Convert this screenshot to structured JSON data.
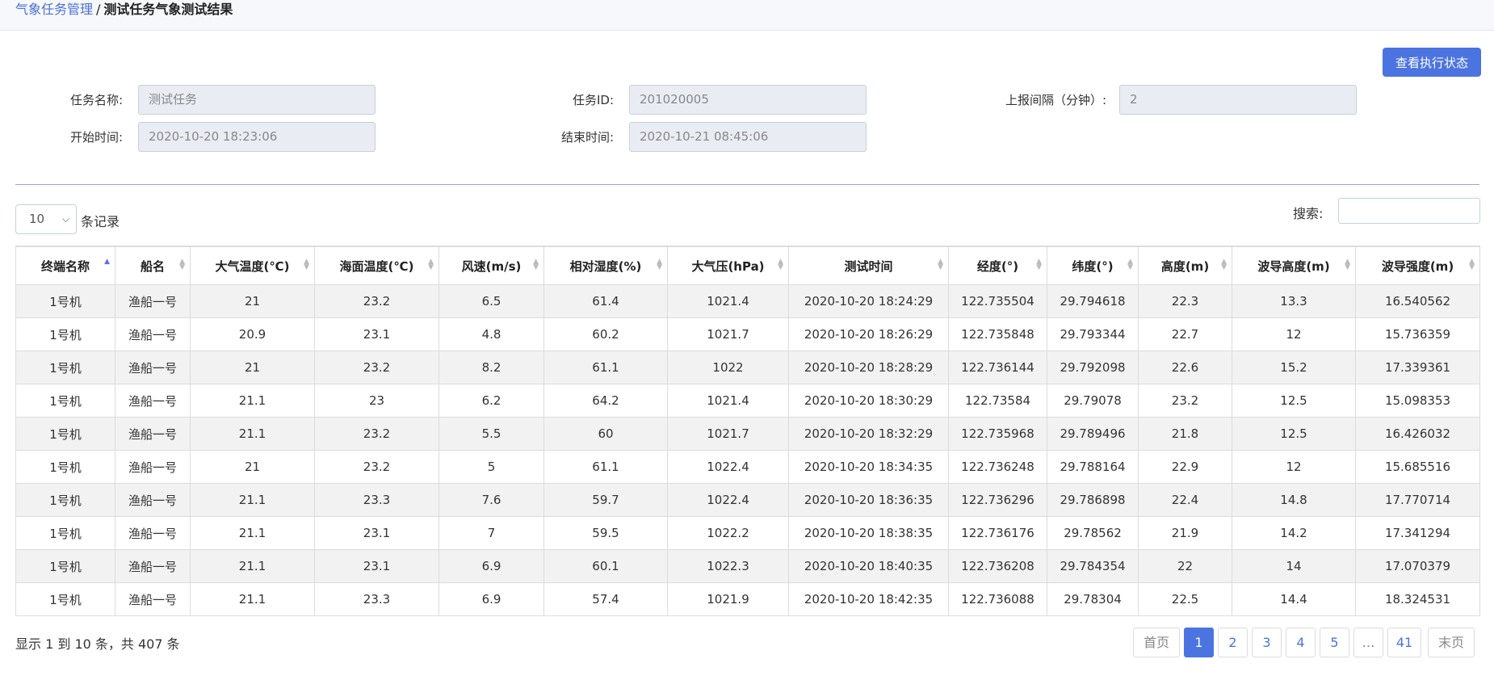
{
  "breadcrumb": {
    "parent": "气象任务管理",
    "separator": "/",
    "current": "测试任务气象测试结果"
  },
  "actions": {
    "view_status": "查看执行状态"
  },
  "form": {
    "task_name_label": "任务名称:",
    "task_name_value": "测试任务",
    "task_id_label": "任务ID:",
    "task_id_value": "201020005",
    "interval_label": "上报间隔（分钟）:",
    "interval_value": "2",
    "start_label": "开始时间:",
    "start_value": "2020-10-20 18:23:06",
    "end_label": "结束时间:",
    "end_value": "2020-10-21 08:45:06"
  },
  "table_controls": {
    "page_length": "10",
    "length_suffix": "条记录",
    "search_label": "搜索:",
    "search_value": ""
  },
  "table": {
    "columns": [
      "终端名称",
      "船名",
      "大气温度(℃)",
      "海面温度(℃)",
      "风速(m/s)",
      "相对湿度(%)",
      "大气压(hPa)",
      "测试时间",
      "经度(°)",
      "纬度(°)",
      "高度(m)",
      "波导高度(m)",
      "波导强度(m)"
    ],
    "rows": [
      [
        "1号机",
        "渔船一号",
        "21",
        "23.2",
        "6.5",
        "61.4",
        "1021.4",
        "2020-10-20 18:24:29",
        "122.735504",
        "29.794618",
        "22.3",
        "13.3",
        "16.540562"
      ],
      [
        "1号机",
        "渔船一号",
        "20.9",
        "23.1",
        "4.8",
        "60.2",
        "1021.7",
        "2020-10-20 18:26:29",
        "122.735848",
        "29.793344",
        "22.7",
        "12",
        "15.736359"
      ],
      [
        "1号机",
        "渔船一号",
        "21",
        "23.2",
        "8.2",
        "61.1",
        "1022",
        "2020-10-20 18:28:29",
        "122.736144",
        "29.792098",
        "22.6",
        "15.2",
        "17.339361"
      ],
      [
        "1号机",
        "渔船一号",
        "21.1",
        "23",
        "6.2",
        "64.2",
        "1021.4",
        "2020-10-20 18:30:29",
        "122.73584",
        "29.79078",
        "23.2",
        "12.5",
        "15.098353"
      ],
      [
        "1号机",
        "渔船一号",
        "21.1",
        "23.2",
        "5.5",
        "60",
        "1021.7",
        "2020-10-20 18:32:29",
        "122.735968",
        "29.789496",
        "21.8",
        "12.5",
        "16.426032"
      ],
      [
        "1号机",
        "渔船一号",
        "21",
        "23.2",
        "5",
        "61.1",
        "1022.4",
        "2020-10-20 18:34:35",
        "122.736248",
        "29.788164",
        "22.9",
        "12",
        "15.685516"
      ],
      [
        "1号机",
        "渔船一号",
        "21.1",
        "23.3",
        "7.6",
        "59.7",
        "1022.4",
        "2020-10-20 18:36:35",
        "122.736296",
        "29.786898",
        "22.4",
        "14.8",
        "17.770714"
      ],
      [
        "1号机",
        "渔船一号",
        "21.1",
        "23.1",
        "7",
        "59.5",
        "1022.2",
        "2020-10-20 18:38:35",
        "122.736176",
        "29.78562",
        "21.9",
        "14.2",
        "17.341294"
      ],
      [
        "1号机",
        "渔船一号",
        "21.1",
        "23.1",
        "6.9",
        "60.1",
        "1022.3",
        "2020-10-20 18:40:35",
        "122.736208",
        "29.784354",
        "22",
        "14",
        "17.070379"
      ],
      [
        "1号机",
        "渔船一号",
        "21.1",
        "23.3",
        "6.9",
        "57.4",
        "1021.9",
        "2020-10-20 18:42:35",
        "122.736088",
        "29.78304",
        "22.5",
        "14.4",
        "18.324531"
      ]
    ]
  },
  "footer": {
    "info": "显示 1 到 10 条，共 407 条",
    "pagination": [
      "首页",
      "1",
      "2",
      "3",
      "4",
      "5",
      "…",
      "41",
      "末页"
    ]
  },
  "colors": {
    "accent": "#4c74e0",
    "divider": "#a79fd0",
    "row_stripe": "#f2f2f2"
  }
}
